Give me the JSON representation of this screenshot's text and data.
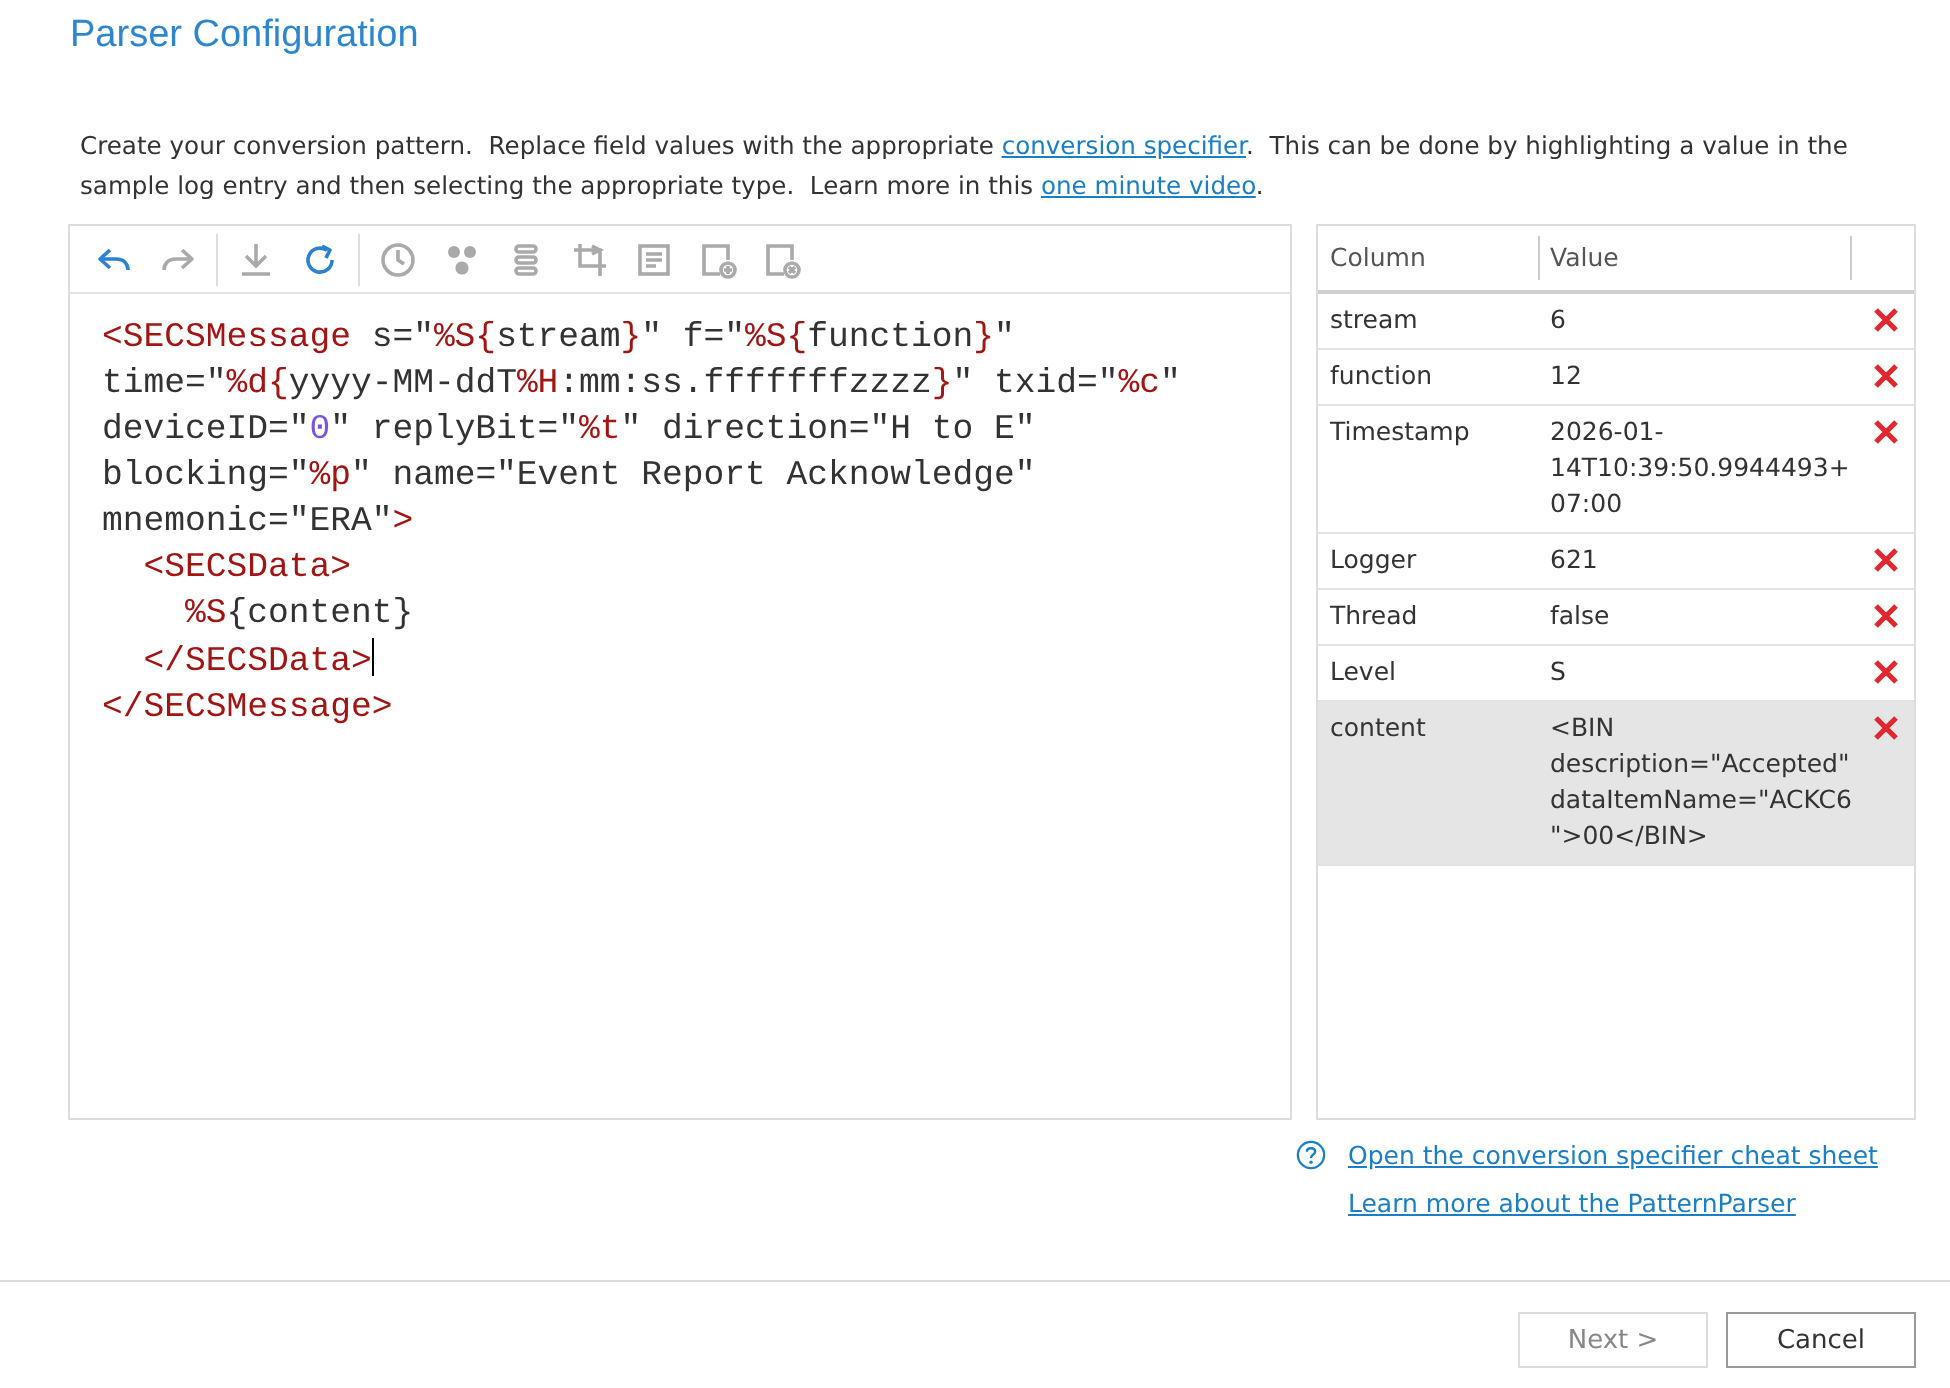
{
  "title": "Parser Configuration",
  "intro": [
    {
      "kind": "text",
      "text": "Create your conversion pattern.  Replace field values with the appropriate "
    },
    {
      "kind": "link",
      "text": "conversion specifier"
    },
    {
      "kind": "text",
      "text": ".  This can be done by highlighting a value in the sample log entry and then selecting the appropriate type.  Learn more in this "
    },
    {
      "kind": "link",
      "text": "one minute video"
    },
    {
      "kind": "text",
      "text": "."
    }
  ],
  "toolbar": [
    {
      "kind": "undo",
      "disabled": false
    },
    {
      "kind": "redo",
      "disabled": true
    },
    {
      "kind": "sep"
    },
    {
      "kind": "download",
      "disabled": true
    },
    {
      "kind": "refresh",
      "disabled": false
    },
    {
      "kind": "sep"
    },
    {
      "kind": "clock",
      "disabled": true
    },
    {
      "kind": "dots",
      "disabled": true
    },
    {
      "kind": "list",
      "disabled": true
    },
    {
      "kind": "crop",
      "disabled": true
    },
    {
      "kind": "doc",
      "disabled": true
    },
    {
      "kind": "doc-add",
      "disabled": true
    },
    {
      "kind": "doc-remove",
      "disabled": true
    }
  ],
  "code_lines": [
    [
      {
        "kind": "markup",
        "text": "<SECSMessage"
      },
      {
        "kind": "text",
        "text": " s=\""
      },
      {
        "kind": "markup",
        "text": "%S{"
      },
      {
        "kind": "text",
        "text": "stream"
      },
      {
        "kind": "markup",
        "text": "}"
      },
      {
        "kind": "text",
        "text": "\" f=\""
      },
      {
        "kind": "markup",
        "text": "%S{"
      },
      {
        "kind": "text",
        "text": "function"
      },
      {
        "kind": "markup",
        "text": "}"
      },
      {
        "kind": "text",
        "text": "\""
      }
    ],
    [
      {
        "kind": "text",
        "text": "time=\""
      },
      {
        "kind": "markup",
        "text": "%d{"
      },
      {
        "kind": "text",
        "text": "yyyy-MM-ddT"
      },
      {
        "kind": "markup",
        "text": "%H"
      },
      {
        "kind": "text",
        "text": ":mm:ss.fffffffzzzz"
      },
      {
        "kind": "markup",
        "text": "}"
      },
      {
        "kind": "text",
        "text": "\" txid=\""
      },
      {
        "kind": "markup",
        "text": "%c"
      },
      {
        "kind": "text",
        "text": "\""
      }
    ],
    [
      {
        "kind": "text",
        "text": "deviceID=\""
      },
      {
        "kind": "number",
        "text": "0"
      },
      {
        "kind": "text",
        "text": "\" replyBit=\""
      },
      {
        "kind": "markup",
        "text": "%t"
      },
      {
        "kind": "text",
        "text": "\" direction=\"H to E\""
      }
    ],
    [
      {
        "kind": "text",
        "text": "blocking=\""
      },
      {
        "kind": "markup",
        "text": "%p"
      },
      {
        "kind": "text",
        "text": "\" name=\"Event Report Acknowledge\""
      }
    ],
    [
      {
        "kind": "text",
        "text": "mnemonic=\"ERA\""
      },
      {
        "kind": "markup",
        "text": ">"
      }
    ],
    [
      {
        "kind": "markup",
        "text": "  <SECSData>"
      }
    ],
    [
      {
        "kind": "markup",
        "text": "    %S"
      },
      {
        "kind": "text",
        "text": "{content}"
      }
    ],
    [
      {
        "kind": "markup",
        "text": "  </SECSData>"
      },
      {
        "kind": "cursor"
      }
    ],
    [
      {
        "kind": "markup",
        "text": "</SECSMessage>"
      }
    ]
  ],
  "table": {
    "columns": [
      "Column",
      "Value"
    ],
    "rows": [
      {
        "column": "stream",
        "value": "6",
        "selected": false
      },
      {
        "column": "function",
        "value": "12",
        "selected": false
      },
      {
        "column": "Timestamp",
        "value": "2026-01-14T10:39:50.9944493+07:00",
        "selected": false
      },
      {
        "column": "Logger",
        "value": "621",
        "selected": false
      },
      {
        "column": "Thread",
        "value": "false",
        "selected": false
      },
      {
        "column": "Level",
        "value": "S",
        "selected": false
      },
      {
        "column": "content",
        "value": "<BIN description=\"Accepted\" dataItemName=\"ACKC6\">00</BIN>",
        "selected": true
      }
    ]
  },
  "links": [
    "Open the conversion specifier cheat sheet",
    "Learn more about the PatternParser"
  ],
  "buttons": [
    {
      "label": "Next >",
      "disabled": true
    },
    {
      "label": "Cancel",
      "disabled": false
    }
  ]
}
